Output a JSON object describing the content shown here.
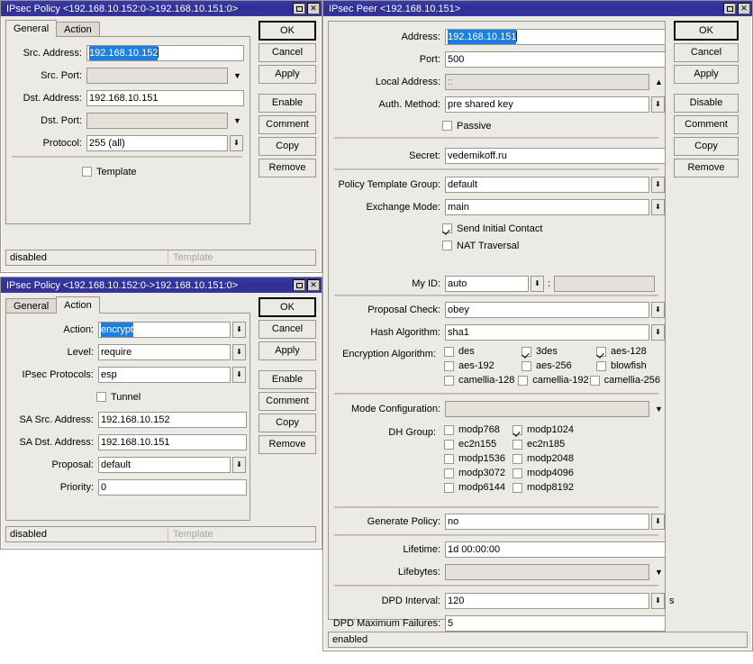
{
  "policy_general": {
    "title": "IPsec Policy <192.168.10.152:0->192.168.10.151:0>",
    "tabs": [
      {
        "label": "General"
      },
      {
        "label": "Action"
      }
    ],
    "active_tab": "General",
    "fields": {
      "src_address_label": "Src. Address:",
      "src_address_value": "192.168.10.152",
      "src_port_label": "Src. Port:",
      "src_port_value": "",
      "dst_address_label": "Dst. Address:",
      "dst_address_value": "192.168.10.151",
      "dst_port_label": "Dst. Port:",
      "dst_port_value": "",
      "protocol_label": "Protocol:",
      "protocol_value": "255 (all)",
      "template_label": "Template",
      "template_checked": false
    },
    "buttons": [
      "OK",
      "Cancel",
      "Apply",
      "Enable",
      "Comment",
      "Copy",
      "Remove"
    ],
    "status": {
      "state": "disabled",
      "flag": "Template"
    }
  },
  "policy_action": {
    "title": "IPsec Policy <192.168.10.152:0->192.168.10.151:0>",
    "tabs": [
      {
        "label": "General"
      },
      {
        "label": "Action"
      }
    ],
    "active_tab": "Action",
    "fields": {
      "action_label": "Action:",
      "action_value": "encrypt",
      "level_label": "Level:",
      "level_value": "require",
      "ipsec_protocols_label": "IPsec Protocols:",
      "ipsec_protocols_value": "esp",
      "tunnel_label": "Tunnel",
      "tunnel_checked": false,
      "sa_src_label": "SA Src. Address:",
      "sa_src_value": "192.168.10.152",
      "sa_dst_label": "SA Dst. Address:",
      "sa_dst_value": "192.168.10.151",
      "proposal_label": "Proposal:",
      "proposal_value": "default",
      "priority_label": "Priority:",
      "priority_value": "0"
    },
    "buttons": [
      "OK",
      "Cancel",
      "Apply",
      "Enable",
      "Comment",
      "Copy",
      "Remove"
    ],
    "status": {
      "state": "disabled",
      "flag": "Template"
    }
  },
  "peer": {
    "title": "IPsec Peer <192.168.10.151>",
    "fields": {
      "address_label": "Address:",
      "address_value": "192.168.10.151",
      "port_label": "Port:",
      "port_value": "500",
      "local_address_label": "Local Address:",
      "local_address_value": "::",
      "auth_method_label": "Auth. Method:",
      "auth_method_value": "pre shared key",
      "passive_label": "Passive",
      "passive_checked": false,
      "secret_label": "Secret:",
      "secret_value": "vedemikoff.ru",
      "policy_template_group_label": "Policy Template Group:",
      "policy_template_group_value": "default",
      "exchange_mode_label": "Exchange Mode:",
      "exchange_mode_value": "main",
      "send_initial_contact_label": "Send Initial Contact",
      "send_initial_contact_checked": true,
      "nat_traversal_label": "NAT Traversal",
      "nat_traversal_checked": false,
      "my_id_label": "My ID:",
      "my_id_value": "auto",
      "my_id_secondary_value": "",
      "proposal_check_label": "Proposal Check:",
      "proposal_check_value": "obey",
      "hash_algorithm_label": "Hash Algorithm:",
      "hash_algorithm_value": "sha1",
      "encryption_algorithm_label": "Encryption Algorithm:",
      "mode_configuration_label": "Mode Configuration:",
      "mode_configuration_value": "",
      "dh_group_label": "DH Group:",
      "generate_policy_label": "Generate Policy:",
      "generate_policy_value": "no",
      "lifetime_label": "Lifetime:",
      "lifetime_value": "1d 00:00:00",
      "lifebytes_label": "Lifebytes:",
      "lifebytes_value": "",
      "dpd_interval_label": "DPD Interval:",
      "dpd_interval_value": "120",
      "dpd_interval_unit": "s",
      "dpd_max_failures_label": "DPD Maximum Failures:",
      "dpd_max_failures_value": "5"
    },
    "encryption_algorithms": [
      {
        "label": "des",
        "checked": false
      },
      {
        "label": "3des",
        "checked": true
      },
      {
        "label": "aes-128",
        "checked": true
      },
      {
        "label": "aes-192",
        "checked": false
      },
      {
        "label": "aes-256",
        "checked": false
      },
      {
        "label": "blowfish",
        "checked": false
      },
      {
        "label": "camellia-128",
        "checked": false
      },
      {
        "label": "camellia-192",
        "checked": false
      },
      {
        "label": "camellia-256",
        "checked": false
      }
    ],
    "dh_groups": [
      {
        "label": "modp768",
        "checked": false
      },
      {
        "label": "modp1024",
        "checked": true
      },
      {
        "label": "ec2n155",
        "checked": false
      },
      {
        "label": "ec2n185",
        "checked": false
      },
      {
        "label": "modp1536",
        "checked": false
      },
      {
        "label": "modp2048",
        "checked": false
      },
      {
        "label": "modp3072",
        "checked": false
      },
      {
        "label": "modp4096",
        "checked": false
      },
      {
        "label": "modp6144",
        "checked": false
      },
      {
        "label": "modp8192",
        "checked": false
      }
    ],
    "buttons": [
      "OK",
      "Cancel",
      "Apply",
      "Disable",
      "Comment",
      "Copy",
      "Remove"
    ],
    "status": {
      "state": "enabled"
    }
  },
  "icons": {
    "maximize": "maximize-icon",
    "close": "✕",
    "spin_down": "⬇",
    "arrow_down": "▼",
    "arrow_up": "▲"
  },
  "colors": {
    "titlebar": "#33339c",
    "selection": "#1c7fe0",
    "window_bg": "#eceae4",
    "field_bg": "#ffffff",
    "field_disabled_bg": "#e4e1db"
  }
}
